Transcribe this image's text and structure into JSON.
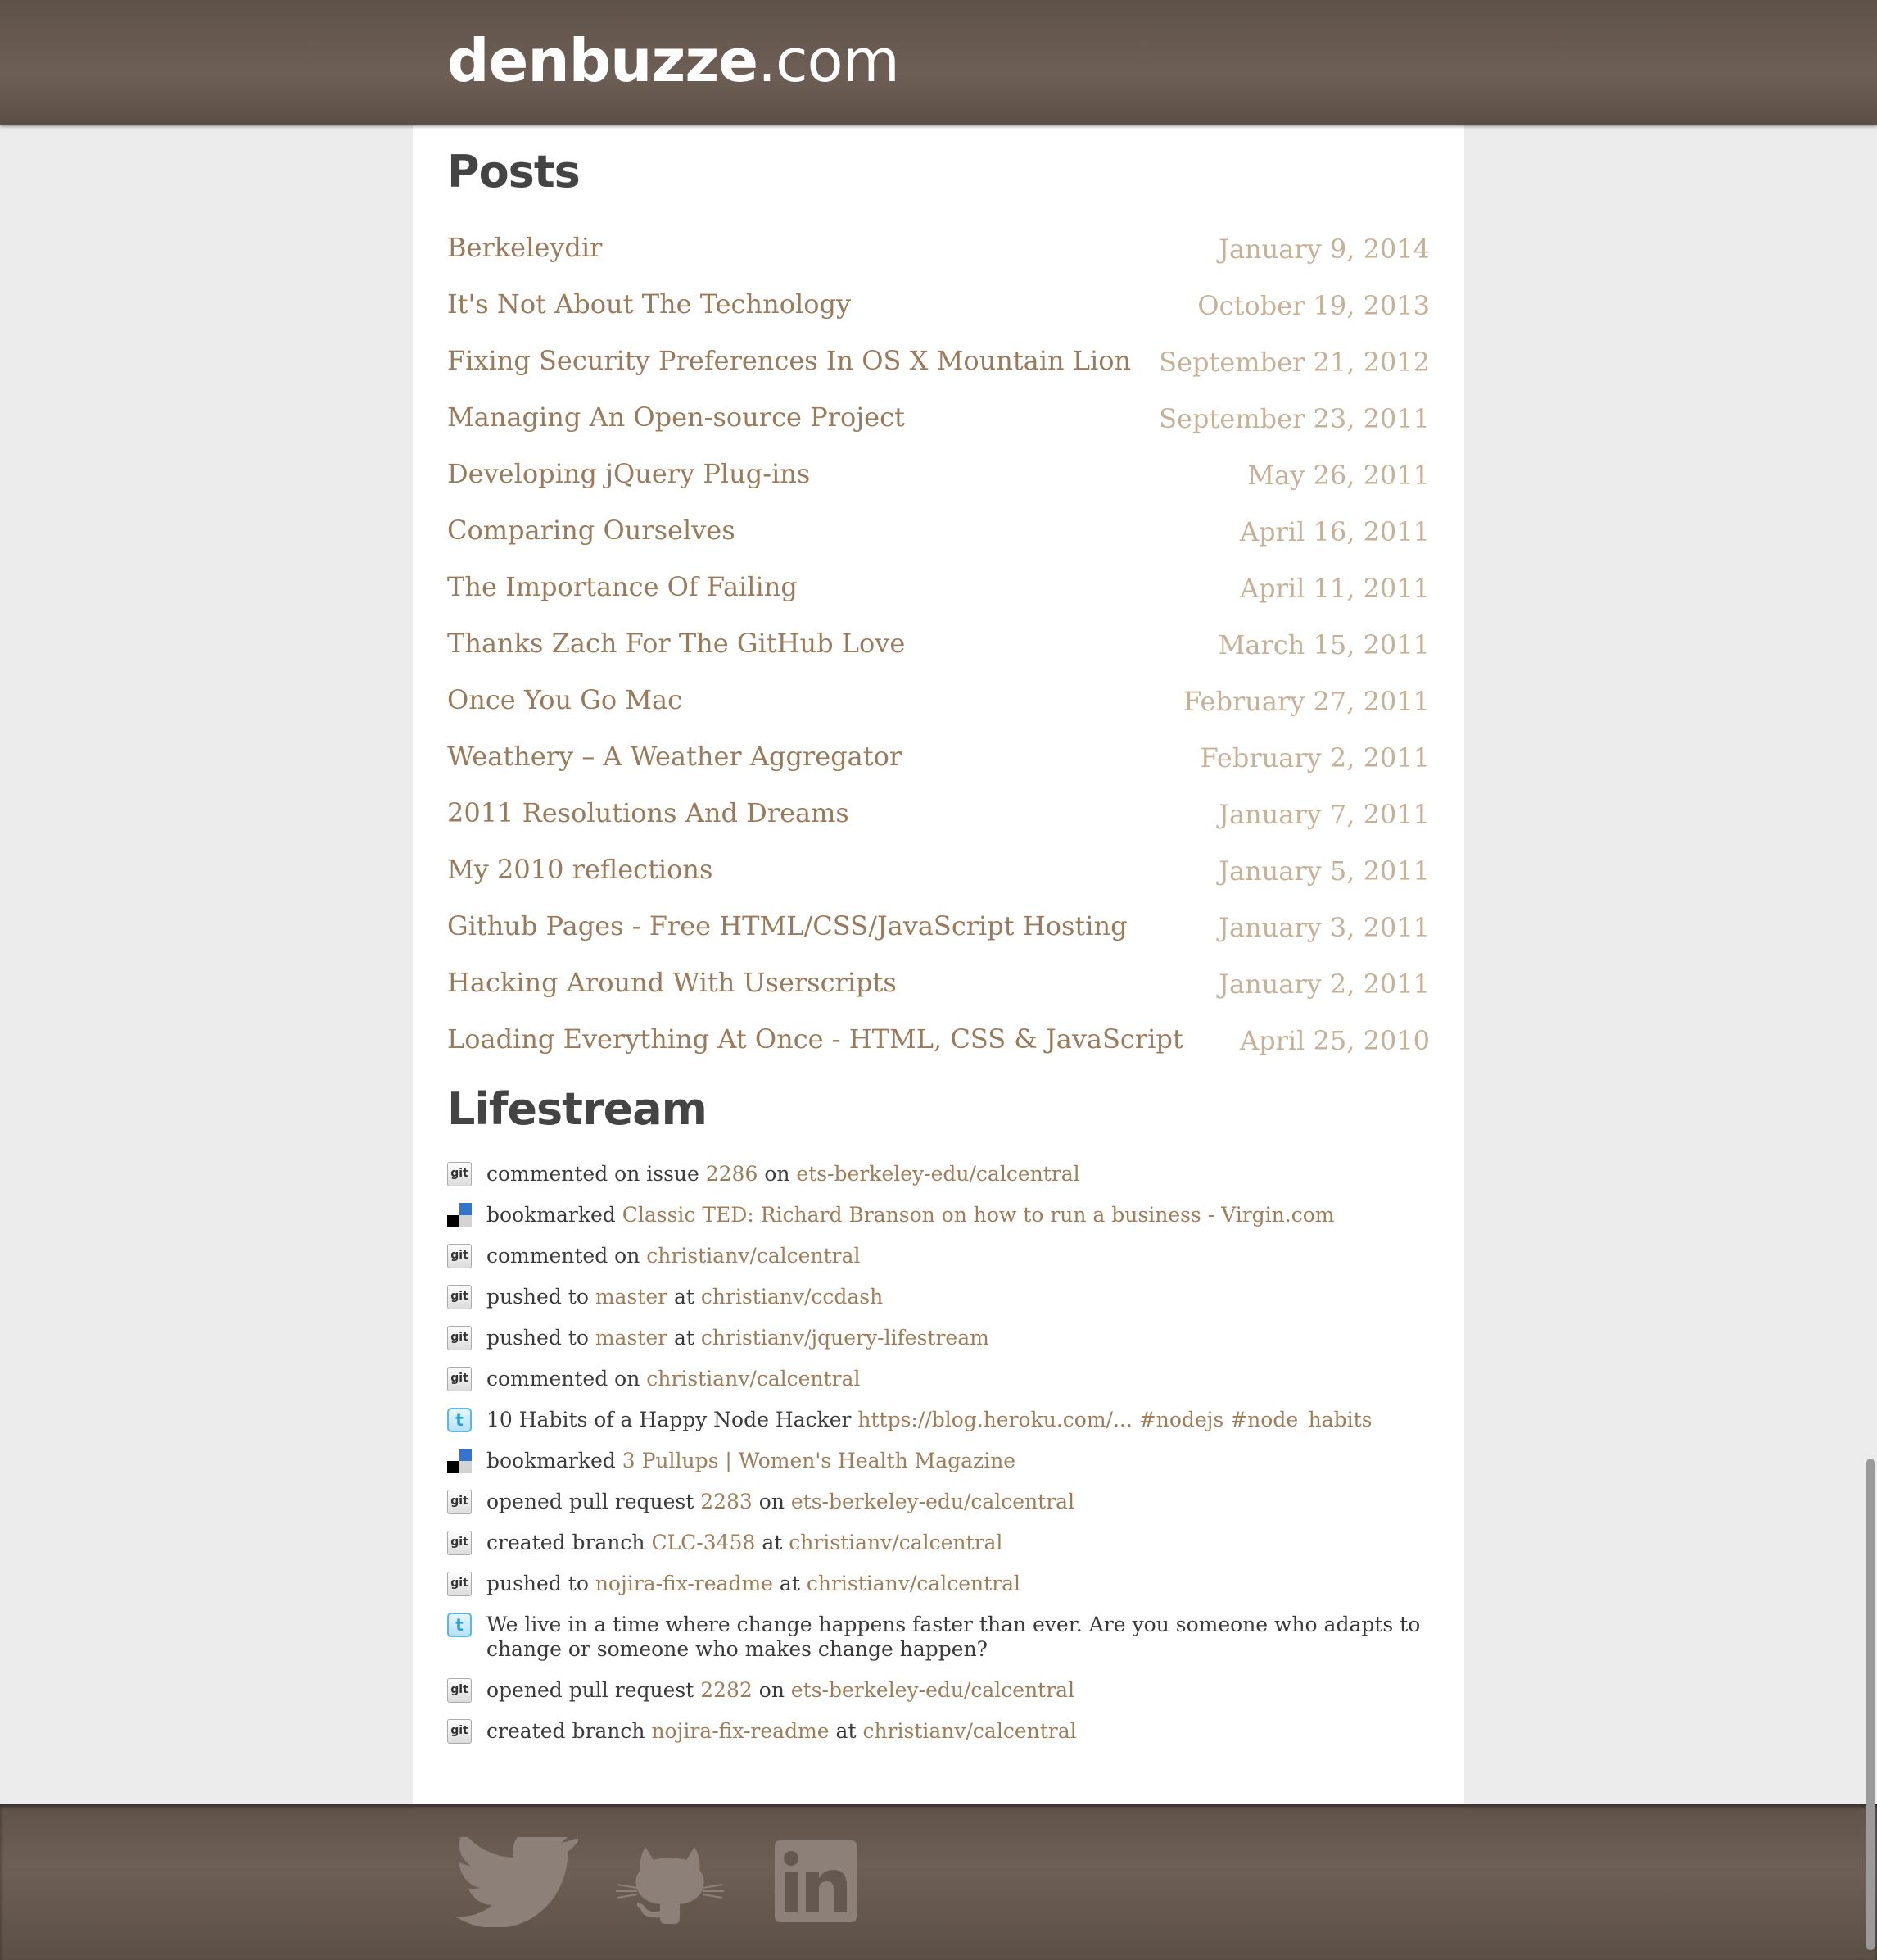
{
  "site": {
    "logo_bold": "denbuzze",
    "logo_light": ".com"
  },
  "posts": {
    "heading": "Posts",
    "items": [
      {
        "title": "Berkeleydir",
        "date": "January 9, 2014"
      },
      {
        "title": "It's Not About The Technology",
        "date": "October 19, 2013"
      },
      {
        "title": "Fixing Security Preferences In OS X Mountain Lion",
        "date": "September 21, 2012"
      },
      {
        "title": "Managing An Open-source Project",
        "date": "September 23, 2011"
      },
      {
        "title": "Developing jQuery Plug-ins",
        "date": "May 26, 2011"
      },
      {
        "title": "Comparing Ourselves",
        "date": "April 16, 2011"
      },
      {
        "title": "The Importance Of Failing",
        "date": "April 11, 2011"
      },
      {
        "title": "Thanks Zach For The GitHub Love",
        "date": "March 15, 2011"
      },
      {
        "title": "Once You Go Mac",
        "date": "February 27, 2011"
      },
      {
        "title": "Weathery – A Weather Aggregator",
        "date": "February 2, 2011"
      },
      {
        "title": "2011 Resolutions And Dreams",
        "date": "January 7, 2011"
      },
      {
        "title": "My 2010 reflections",
        "date": "January 5, 2011"
      },
      {
        "title": "Github Pages - Free HTML/CSS/JavaScript Hosting",
        "date": "January 3, 2011"
      },
      {
        "title": "Hacking Around With Userscripts",
        "date": "January 2, 2011"
      },
      {
        "title": "Loading Everything At Once - HTML, CSS & JavaScript",
        "date": "April 25, 2010"
      }
    ]
  },
  "lifestream": {
    "heading": "Lifestream",
    "items": [
      {
        "icon": "github-icon",
        "parts": [
          {
            "t": "commented on issue "
          },
          {
            "t": "2286",
            "link": true
          },
          {
            "t": " on "
          },
          {
            "t": "ets-berkeley-edu/calcentral",
            "link": true
          }
        ]
      },
      {
        "icon": "delicious-icon",
        "parts": [
          {
            "t": "bookmarked "
          },
          {
            "t": "Classic TED: Richard Branson on how to run a business - Virgin.com",
            "link": true
          }
        ]
      },
      {
        "icon": "github-icon",
        "parts": [
          {
            "t": "commented on "
          },
          {
            "t": "christianv/calcentral",
            "link": true
          }
        ]
      },
      {
        "icon": "github-icon",
        "parts": [
          {
            "t": "pushed to "
          },
          {
            "t": "master",
            "link": true
          },
          {
            "t": " at "
          },
          {
            "t": "christianv/ccdash",
            "link": true
          }
        ]
      },
      {
        "icon": "github-icon",
        "parts": [
          {
            "t": "pushed to "
          },
          {
            "t": "master",
            "link": true
          },
          {
            "t": " at "
          },
          {
            "t": "christianv/jquery-lifestream",
            "link": true
          }
        ]
      },
      {
        "icon": "github-icon",
        "parts": [
          {
            "t": "commented on "
          },
          {
            "t": "christianv/calcentral",
            "link": true
          }
        ]
      },
      {
        "icon": "twitter-icon",
        "parts": [
          {
            "t": "10 Habits of a Happy Node Hacker "
          },
          {
            "t": "https://blog.heroku.com/...",
            "link": true
          },
          {
            "t": " "
          },
          {
            "t": "#nodejs",
            "link": true
          },
          {
            "t": " "
          },
          {
            "t": "#node_habits",
            "link": true
          }
        ]
      },
      {
        "icon": "delicious-icon",
        "parts": [
          {
            "t": "bookmarked "
          },
          {
            "t": "3 Pullups | Women's Health Magazine",
            "link": true
          }
        ]
      },
      {
        "icon": "github-icon",
        "parts": [
          {
            "t": "opened pull request "
          },
          {
            "t": "2283",
            "link": true
          },
          {
            "t": " on "
          },
          {
            "t": "ets-berkeley-edu/calcentral",
            "link": true
          }
        ]
      },
      {
        "icon": "github-icon",
        "parts": [
          {
            "t": "created branch "
          },
          {
            "t": "CLC-3458",
            "link": true
          },
          {
            "t": " at "
          },
          {
            "t": "christianv/calcentral",
            "link": true
          }
        ]
      },
      {
        "icon": "github-icon",
        "parts": [
          {
            "t": "pushed to "
          },
          {
            "t": "nojira-fix-readme",
            "link": true
          },
          {
            "t": " at "
          },
          {
            "t": "christianv/calcentral",
            "link": true
          }
        ]
      },
      {
        "icon": "twitter-icon",
        "parts": [
          {
            "t": "We live in a time where change happens faster than ever. Are you someone who adapts to change or someone who makes change happen?"
          }
        ]
      },
      {
        "icon": "github-icon",
        "parts": [
          {
            "t": "opened pull request "
          },
          {
            "t": "2282",
            "link": true
          },
          {
            "t": " on "
          },
          {
            "t": "ets-berkeley-edu/calcentral",
            "link": true
          }
        ]
      },
      {
        "icon": "github-icon",
        "parts": [
          {
            "t": "created branch "
          },
          {
            "t": "nojira-fix-readme",
            "link": true
          },
          {
            "t": " at "
          },
          {
            "t": "christianv/calcentral",
            "link": true
          }
        ]
      }
    ]
  },
  "footer": {
    "links": [
      {
        "name": "twitter-link",
        "icon": "twitter-bird-icon"
      },
      {
        "name": "github-link",
        "icon": "octocat-icon"
      },
      {
        "name": "linkedin-link",
        "icon": "linkedin-icon"
      }
    ]
  },
  "colors": {
    "header_bg": "#655850",
    "link": "#9a7a58",
    "date": "#c6b197",
    "heading": "#444444",
    "footer_icon": "#8c8078"
  }
}
